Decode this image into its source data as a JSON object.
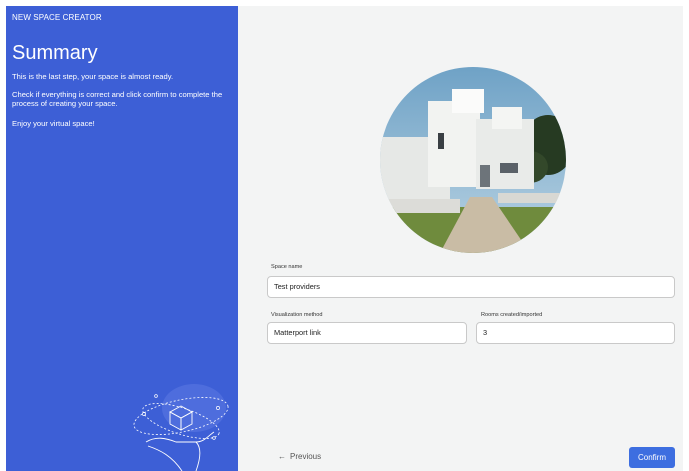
{
  "header": {
    "app_title": "NEW SPACE CREATOR",
    "page_title": "Summary",
    "desc_1": "This is the last step, your space is almost ready.",
    "desc_2": "Check if everything is correct and click confirm to complete the process of creating your space.",
    "desc_3": "Enjoy your virtual space!"
  },
  "form": {
    "space_name_label": "Space name",
    "space_name_value": "Test providers",
    "visualization_label": "Visualization method",
    "visualization_value": "Matterport link",
    "rooms_label": "Rooms created/imported",
    "rooms_value": "3"
  },
  "footer": {
    "previous_label": "Previous",
    "previous_icon": "arrow-left-icon",
    "confirm_label": "Confirm"
  },
  "colors": {
    "panel": "#3d5fd6",
    "accent": "#3d6ee0",
    "background": "#f3f4f4"
  }
}
